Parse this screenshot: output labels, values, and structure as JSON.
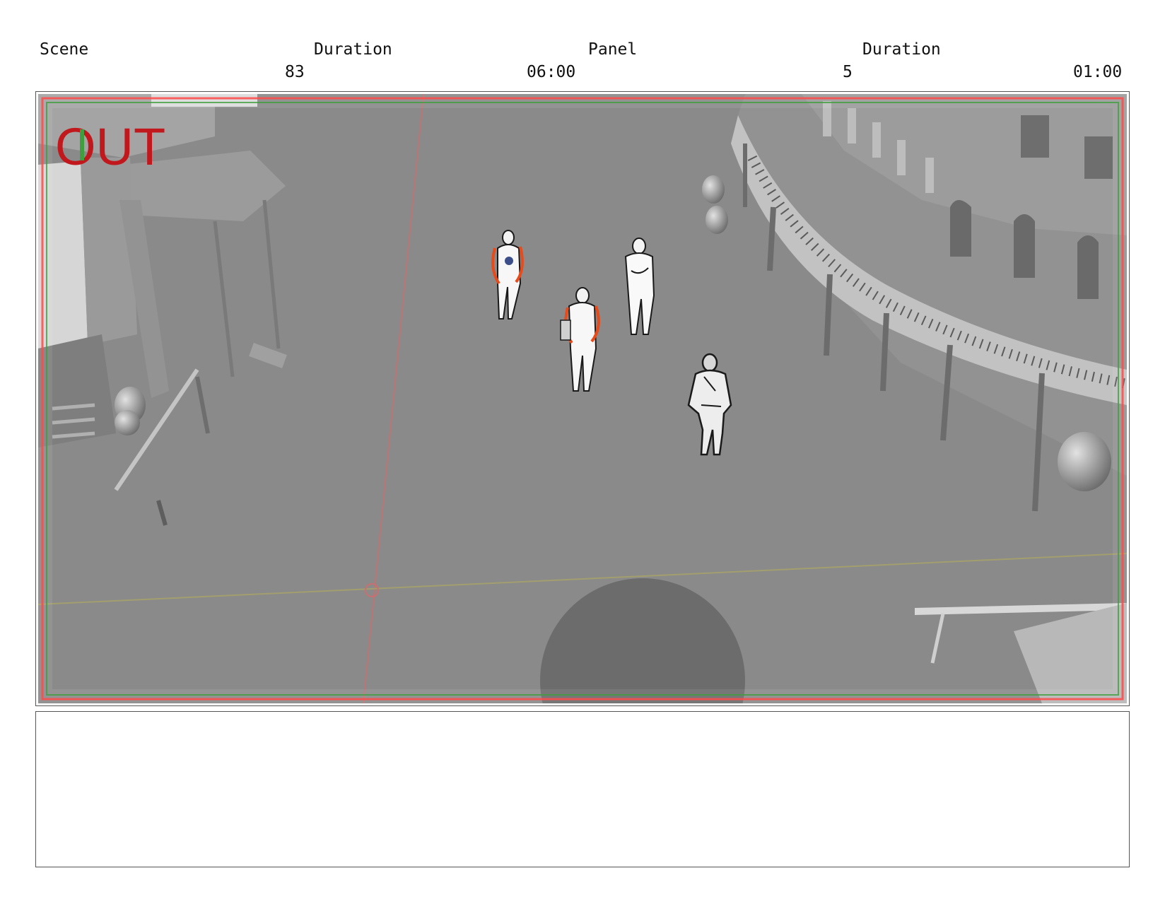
{
  "header": {
    "scene_label": "Scene",
    "scene_duration_label": "Duration",
    "panel_label": "Panel",
    "panel_duration_label": "Duration",
    "scene_number": "83",
    "scene_duration": "06:00",
    "panel_number": "5",
    "panel_duration": "01:00"
  },
  "frame": {
    "overlay_text": "OUT",
    "overlay_color": "#c0181c",
    "safe_line_color": "#ff4a4a",
    "title_safe_color": "#3f9f3f"
  },
  "notes": {
    "text": ""
  }
}
